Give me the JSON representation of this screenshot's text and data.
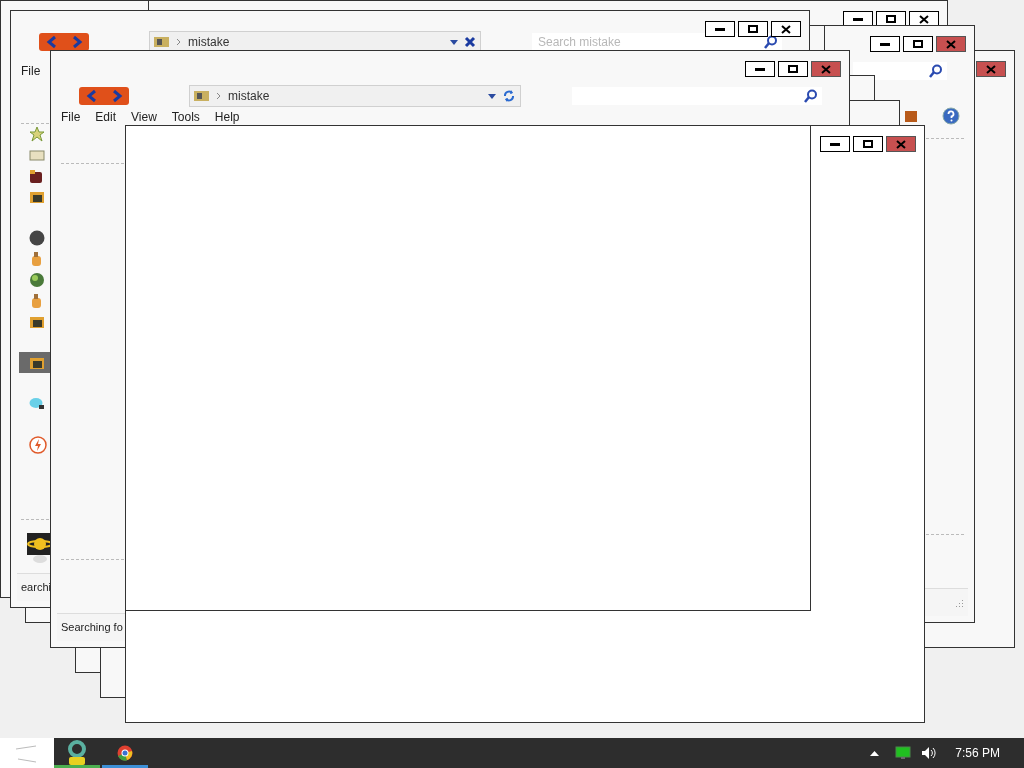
{
  "windows": [
    {
      "kind": "blank"
    },
    {
      "kind": "blank",
      "close_highlighted": false
    },
    {
      "kind": "blank",
      "close_highlighted": true
    },
    {
      "kind": "explorer",
      "close_highlighted": true
    },
    {
      "kind": "blank"
    },
    {
      "kind": "blank"
    },
    {
      "kind": "blank"
    },
    {
      "kind": "explorer",
      "close_highlighted": false,
      "address": "mistake",
      "stop": true,
      "search_placeholder": "Search mistake",
      "menu": [
        "File"
      ],
      "sidebar": [
        [
          {
            "kind": "star",
            "selected": false
          },
          {
            "kind": "note",
            "selected": false
          },
          {
            "kind": "bag",
            "selected": false
          },
          {
            "kind": "folder",
            "selected": false
          }
        ],
        [
          {
            "kind": "disc",
            "selected": false
          },
          {
            "kind": "bottle",
            "selected": false
          },
          {
            "kind": "globe",
            "selected": false
          },
          {
            "kind": "bottle",
            "selected": false
          },
          {
            "kind": "folder",
            "selected": false
          }
        ],
        [
          {
            "kind": "folder",
            "selected": true
          }
        ],
        [
          {
            "kind": "balloon",
            "selected": false
          }
        ],
        [
          {
            "kind": "bolt",
            "selected": false
          }
        ]
      ],
      "footer_icon": true,
      "status": "earchi"
    },
    {
      "kind": "explorer",
      "close_highlighted": true,
      "address": "mistake",
      "refresh": true,
      "menu": [
        "File",
        "Edit",
        "View",
        "Tools",
        "Help"
      ],
      "status": "Searching fo"
    },
    {
      "kind": "frame",
      "close_highlighted": true
    }
  ],
  "taskbar": {
    "apps": [
      {
        "kind": "ring",
        "color": "#4caf50"
      },
      {
        "kind": "browser",
        "color": "#3d8fd6"
      }
    ],
    "clock": "7:56 PM"
  }
}
